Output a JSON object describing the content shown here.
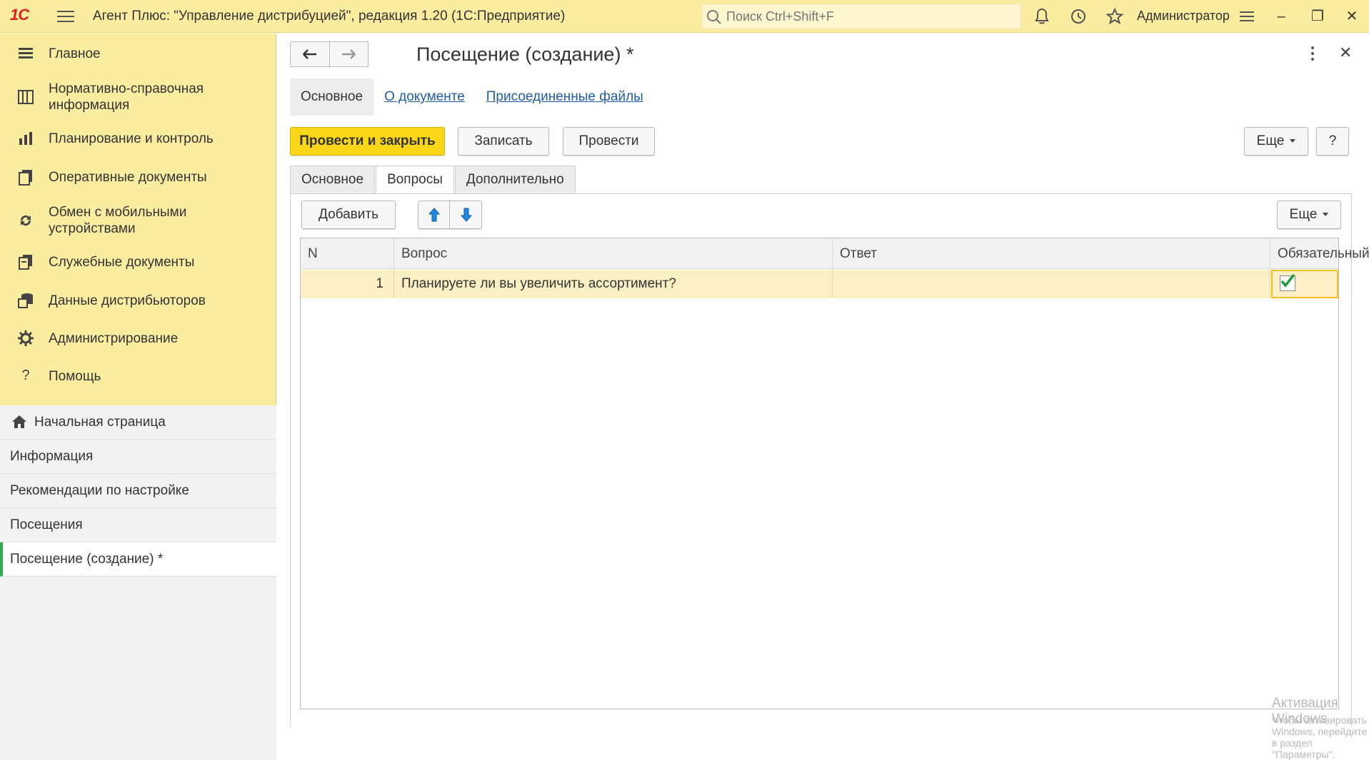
{
  "titlebar": {
    "logo": "1С",
    "app_title": "Агент Плюс: \"Управление дистрибуцией\", редакция 1.20  (1С:Предприятие)",
    "search_placeholder": "Поиск Ctrl+Shift+F",
    "user": "Администратор"
  },
  "sidebar": {
    "items": [
      {
        "label": "Главное",
        "icon": "list-icon"
      },
      {
        "label": "Нормативно-справочная информация",
        "icon": "reference-icon"
      },
      {
        "label": "Планирование и контроль",
        "icon": "chart-icon"
      },
      {
        "label": "Оперативные документы",
        "icon": "documents-icon"
      },
      {
        "label": "Обмен с мобильными устройствами",
        "icon": "sync-icon"
      },
      {
        "label": "Служебные документы",
        "icon": "service-docs-icon"
      },
      {
        "label": "Данные дистрибьюторов",
        "icon": "database-icon"
      },
      {
        "label": "Администрирование",
        "icon": "gear-icon"
      },
      {
        "label": "Помощь",
        "icon": "help-icon"
      }
    ],
    "open_windows": [
      {
        "label": "Начальная страница",
        "icon": "home-icon"
      },
      {
        "label": "Информация"
      },
      {
        "label": "Рекомендации по настройке"
      },
      {
        "label": "Посещения"
      },
      {
        "label": "Посещение (создание) *"
      }
    ]
  },
  "document": {
    "title": "Посещение (создание) *",
    "top_tabs": [
      "Основное",
      "О документе",
      "Присоединенные файлы"
    ],
    "buttons": {
      "post_close": "Провести и закрыть",
      "save": "Записать",
      "post": "Провести",
      "more": "Еще",
      "help": "?"
    },
    "inner_tabs": [
      "Основное",
      "Вопросы",
      "Дополнительно"
    ],
    "questions_toolbar": {
      "add": "Добавить",
      "more": "Еще"
    },
    "table": {
      "columns": [
        "N",
        "Вопрос",
        "Ответ",
        "Обязательный"
      ],
      "rows": [
        {
          "n": "1",
          "question": "Планируете ли вы увеличить ассортимент?",
          "answer": "",
          "required": true
        }
      ]
    }
  },
  "watermark": {
    "line1": "Активация Windows",
    "line2": "Чтобы активировать Windows, перейдите в раздел \"Параметры\"."
  },
  "colors": {
    "accent_yellow": "#fbeda0",
    "primary_button": "#f9d718",
    "link": "#1f5ea8",
    "active_marker": "#34a853",
    "selected_row": "#fbf0c3"
  }
}
